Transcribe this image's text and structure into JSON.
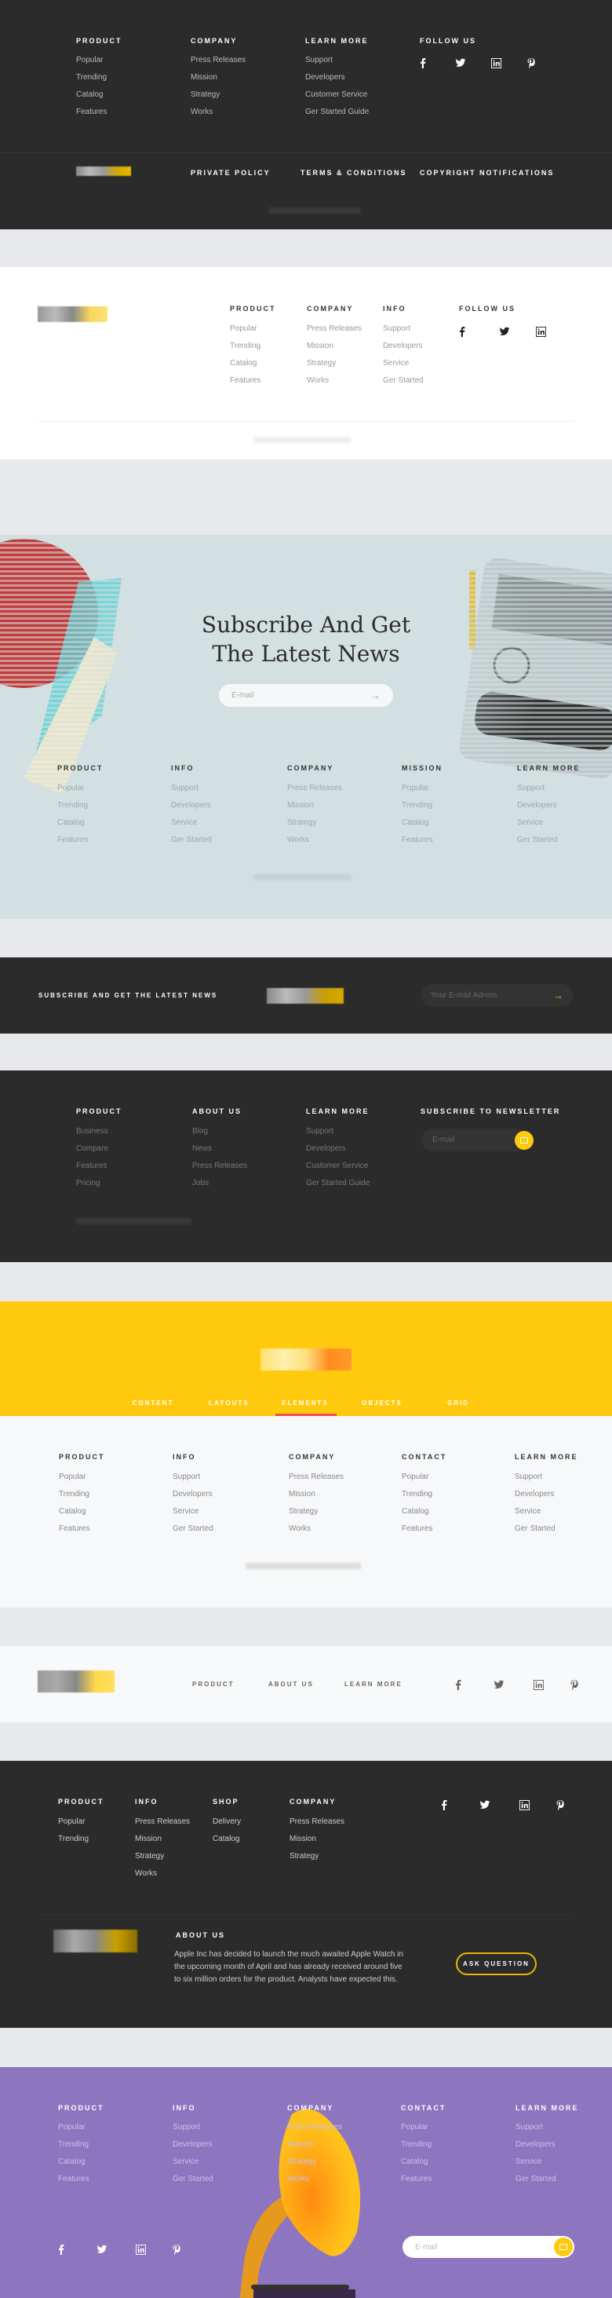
{
  "colors": {
    "dark": "#2b2b2b",
    "gap": "#e8e9ec",
    "yellow": "#ffc90e",
    "purple": "#8e75c0",
    "hero": "#d3e0e1",
    "accent_red": "#f04e4e"
  },
  "footer1": {
    "columns": [
      {
        "title": "PRODUCT",
        "links": [
          "Popular",
          "Trending",
          "Catalog",
          "Features"
        ]
      },
      {
        "title": "COMPANY",
        "links": [
          "Press Releases",
          "Mission",
          "Strategy",
          "Works"
        ]
      },
      {
        "title": "LEARN MORE",
        "links": [
          "Support",
          "Developers",
          "Customer Service",
          "Ger Started Guide"
        ]
      }
    ],
    "follow_title": "FOLLOW US",
    "social": [
      "facebook-icon",
      "twitter-icon",
      "linkedin-icon",
      "pinterest-icon"
    ],
    "bottom_links": [
      "PRIVATE POLICY",
      "TERMS & CONDITIONS",
      "COPYRIGHT NOTIFICATIONS"
    ]
  },
  "footer2": {
    "columns": [
      {
        "title": "PRODUCT",
        "links": [
          "Popular",
          "Trending",
          "Catalog",
          "Features"
        ]
      },
      {
        "title": "COMPANY",
        "links": [
          "Press Releases",
          "Mission",
          "Strategy",
          "Works"
        ]
      },
      {
        "title": "INFO",
        "links": [
          "Support",
          "Developers",
          "Service",
          "Ger Started"
        ]
      }
    ],
    "follow_title": "FOLLOW US",
    "social": [
      "facebook-icon",
      "twitter-icon",
      "linkedin-icon"
    ]
  },
  "hero": {
    "title_line1": "Subscribe And Get",
    "title_line2": "The Latest News",
    "email_placeholder": "E-mail",
    "columns": [
      {
        "title": "PRODUCT",
        "links": [
          "Popular",
          "Trending",
          "Catalog",
          "Features"
        ]
      },
      {
        "title": "INFO",
        "links": [
          "Support",
          "Developers",
          "Service",
          "Ger Started"
        ]
      },
      {
        "title": "COMPANY",
        "links": [
          "Press Releases",
          "Mission",
          "Strategy",
          "Works"
        ]
      },
      {
        "title": "MISSION",
        "links": [
          "Popular",
          "Trending",
          "Catalog",
          "Features"
        ]
      },
      {
        "title": "LEARN MORE",
        "links": [
          "Support",
          "Developers",
          "Service",
          "Ger Started"
        ]
      }
    ]
  },
  "bar": {
    "text": "SUBSCRIBE AND GET THE LATEST NEWS",
    "email_placeholder": "Your E-mail Adress"
  },
  "footer3": {
    "columns": [
      {
        "title": "PRODUCT",
        "links": [
          "Business",
          "Compare",
          "Features",
          "Pricing"
        ]
      },
      {
        "title": "ABOUT US",
        "links": [
          "Blog",
          "News",
          "Press Releases",
          "Jobs"
        ]
      },
      {
        "title": "LEARN MORE",
        "links": [
          "Support",
          "Developers",
          "Customer Service",
          "Ger Started Guide"
        ]
      }
    ],
    "newsletter_title": "SUBSCRIBE TO NEWSLETTER",
    "email_placeholder": "E-mail"
  },
  "yellow": {
    "nav": [
      "CONTENT",
      "LAYOUTS",
      "ELEMENTS",
      "OBJECTS",
      "GRID"
    ],
    "active_nav": "ELEMENTS",
    "columns": [
      {
        "title": "PRODUCT",
        "links": [
          "Popular",
          "Trending",
          "Catalog",
          "Features"
        ]
      },
      {
        "title": "INFO",
        "links": [
          "Support",
          "Developers",
          "Service",
          "Ger Started"
        ]
      },
      {
        "title": "COMPANY",
        "links": [
          "Press Releases",
          "Mission",
          "Strategy",
          "Works"
        ]
      },
      {
        "title": "CONTACT",
        "links": [
          "Popular",
          "Trending",
          "Catalog",
          "Features"
        ]
      },
      {
        "title": "LEARN MORE",
        "links": [
          "Support",
          "Developers",
          "Service",
          "Ger Started"
        ]
      }
    ]
  },
  "navbar": {
    "links": [
      "PRODUCT",
      "ABOUT US",
      "LEARN MORE"
    ],
    "social": [
      "facebook-icon",
      "twitter-icon",
      "linkedin-icon",
      "pinterest-icon"
    ]
  },
  "footer4": {
    "columns": [
      {
        "title": "PRODUCT",
        "links": [
          "Popular",
          "Trending"
        ]
      },
      {
        "title": "INFO",
        "links": [
          "Press Releases",
          "Mission",
          "Strategy",
          "Works"
        ]
      },
      {
        "title": "SHOP",
        "links": [
          "Delivery",
          "Catalog"
        ]
      },
      {
        "title": "COMPANY",
        "links": [
          "Press Releases",
          "Mission",
          "Strategy"
        ]
      }
    ],
    "social": [
      "facebook-icon",
      "twitter-icon",
      "linkedin-icon",
      "pinterest-icon"
    ],
    "about_title": "ABOUT US",
    "about_lines": [
      "Apple Inc has decided to launch the much awaited Apple Watch in",
      "the upcoming month of April and has already received around five",
      "to six million orders for the product. Analysts have expected this."
    ],
    "ask_button": "ASK QUESTION"
  },
  "purple": {
    "columns": [
      {
        "title": "PRODUCT",
        "links": [
          "Popular",
          "Trending",
          "Catalog",
          "Features"
        ]
      },
      {
        "title": "INFO",
        "links": [
          "Support",
          "Developers",
          "Service",
          "Ger Started"
        ]
      },
      {
        "title": "COMPANY",
        "links": [
          "Press Releases",
          "Mission",
          "Strategy",
          "Works"
        ]
      },
      {
        "title": "CONTACT",
        "links": [
          "Popular",
          "Trending",
          "Catalog",
          "Features"
        ]
      },
      {
        "title": "LEARN MORE",
        "links": [
          "Support",
          "Developers",
          "Service",
          "Ger Started"
        ]
      }
    ],
    "social": [
      "facebook-icon",
      "twitter-icon",
      "linkedin-icon",
      "pinterest-icon"
    ],
    "email_placeholder": "E-mail"
  }
}
